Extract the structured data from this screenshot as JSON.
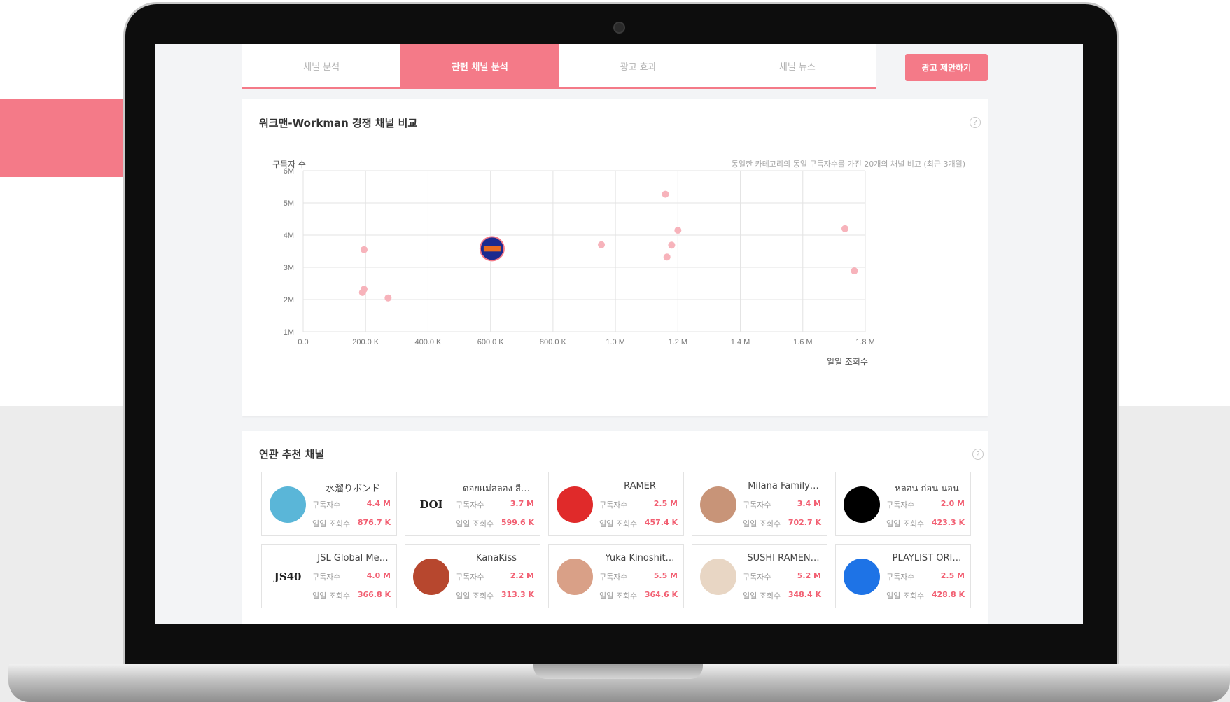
{
  "colors": {
    "accent": "#f47a88",
    "value_text": "#f25f72",
    "point": "#f7b3bb"
  },
  "tabs": [
    {
      "label": "채널 분석",
      "active": false
    },
    {
      "label": "관련 채널 분석",
      "active": true
    },
    {
      "label": "광고 효과",
      "active": false
    },
    {
      "label": "채널 뉴스",
      "active": false
    }
  ],
  "cta": {
    "label": "광고 제안하기"
  },
  "comparison": {
    "title": "워크맨-Workman 경쟁 채널 비교",
    "y_title": "구독자 수",
    "note": "동일한 카테고리의 동일 구독자수를 가진 20개의 채널 비교 (최근 3개월)",
    "x_title": "일일 조회수",
    "help_icon": "question-icon"
  },
  "chart_data": {
    "type": "scatter",
    "xlabel": "일일 조회수",
    "ylabel": "구독자 수",
    "xlim": [
      0,
      1800000
    ],
    "ylim": [
      1000000,
      6000000
    ],
    "x_ticks": [
      "0.0",
      "200.0 K",
      "400.0 K",
      "600.0 K",
      "800.0 K",
      "1.0 M",
      "1.2 M",
      "1.4 M",
      "1.6 M",
      "1.8 M"
    ],
    "y_ticks": [
      "1M",
      "2M",
      "3M",
      "4M",
      "5M",
      "6M"
    ],
    "grid": true,
    "points": [
      {
        "x": 195000,
        "y": 3550000
      },
      {
        "x": 195000,
        "y": 2320000
      },
      {
        "x": 190000,
        "y": 2220000
      },
      {
        "x": 272000,
        "y": 2050000
      },
      {
        "x": 605000,
        "y": 3580000,
        "highlight": true
      },
      {
        "x": 955000,
        "y": 3700000
      },
      {
        "x": 1160000,
        "y": 5270000
      },
      {
        "x": 1200000,
        "y": 4150000
      },
      {
        "x": 1180000,
        "y": 3690000
      },
      {
        "x": 1165000,
        "y": 3320000
      },
      {
        "x": 1735000,
        "y": 4200000
      },
      {
        "x": 1765000,
        "y": 2890000
      }
    ]
  },
  "recommend": {
    "title": "연관 추천 채널",
    "subs_label": "구독자수",
    "views_label": "일일 조회수",
    "channels": [
      {
        "name": "水溜りボンド",
        "subs": "4.4 M",
        "views": "876.7 K",
        "avatar_color": "#5ab6d8",
        "avatar": "avatar-photo"
      },
      {
        "name": "ดอยแม่สลอง สื่…",
        "subs": "3.7 M",
        "views": "599.6 K",
        "avatar_color": "#ffffff",
        "avatar": "doi-logo",
        "logo_text": "DOI"
      },
      {
        "name": "RAMER",
        "subs": "2.5 M",
        "views": "457.4 K",
        "avatar_color": "#e02a2a",
        "avatar": "ramer-logo"
      },
      {
        "name": "Milana Family…",
        "subs": "3.4 M",
        "views": "702.7 K",
        "avatar_color": "#c89478",
        "avatar": "avatar-photo"
      },
      {
        "name": "หลอน ก่อน นอน",
        "subs": "2.0 M",
        "views": "423.3 K",
        "avatar_color": "#000000",
        "avatar": "avatar-logo"
      },
      {
        "name": "JSL Global Me…",
        "subs": "4.0 M",
        "views": "366.8 K",
        "avatar_color": "#ffffff",
        "avatar": "jsl-logo",
        "logo_text": "JS40"
      },
      {
        "name": "KanaKiss",
        "subs": "2.2 M",
        "views": "313.3 K",
        "avatar_color": "#b7472e",
        "avatar": "avatar-photo"
      },
      {
        "name": "Yuka Kinoshit…",
        "subs": "5.5 M",
        "views": "364.6 K",
        "avatar_color": "#d9a087",
        "avatar": "avatar-photo"
      },
      {
        "name": "SUSHI RAMEN…",
        "subs": "5.2 M",
        "views": "348.4 K",
        "avatar_color": "#e8d6c4",
        "avatar": "avatar-photo"
      },
      {
        "name": "PLAYLIST ORI…",
        "subs": "2.5 M",
        "views": "428.8 K",
        "avatar_color": "#1e73e6",
        "avatar": "playlist-logo"
      }
    ]
  }
}
